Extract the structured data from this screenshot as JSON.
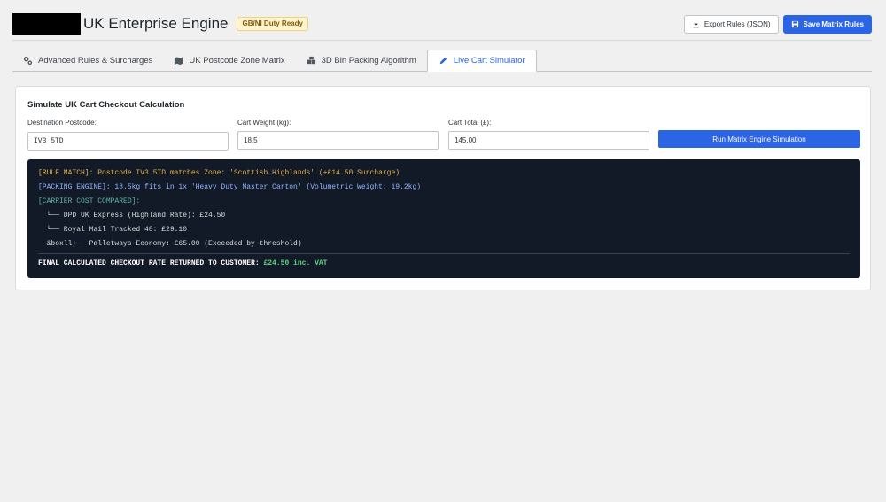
{
  "header": {
    "title": "UK Enterprise Engine",
    "badge": "GB/NI Duty Ready",
    "export_label": "Export Rules (JSON)",
    "save_label": "Save Matrix Rules"
  },
  "tabs": [
    {
      "label": "Advanced Rules & Surcharges",
      "icon": "gears-icon"
    },
    {
      "label": "UK Postcode Zone Matrix",
      "icon": "map-icon"
    },
    {
      "label": "3D Bin Packing Algorithm",
      "icon": "boxes-icon"
    },
    {
      "label": "Live Cart Simulator",
      "icon": "pencil-icon",
      "active": true
    }
  ],
  "simulator": {
    "title": "Simulate UK Cart Checkout Calculation",
    "postcode_label": "Destination Postcode:",
    "postcode_value": "IV3 5TD",
    "weight_label": "Cart Weight (kg):",
    "weight_value": "18.5",
    "total_label": "Cart Total (£):",
    "total_value": "145.00",
    "run_label": "Run Matrix Engine Simulation"
  },
  "console": {
    "rule_match": "[RULE MATCH]: Postcode IV3 5TD matches Zone: 'Scottish Highlands' (+£14.50 Surcharge)",
    "packing": "[PACKING ENGINE]: 18.5kg fits in 1x 'Heavy Duty Master Carton' (Volumetric Weight: 19.2kg)",
    "carrier_header": "[CARRIER COST COMPARED]:",
    "carrier_1": "  └── DPD UK Express (Highland Rate): £24.50",
    "carrier_2": "  └── Royal Mail Tracked 48: £29.10",
    "carrier_3": "  &boxll;── Palletways Economy: £65.00 (Exceeded by threshold)",
    "final_label": "FINAL CALCULATED CHECKOUT RATE RETURNED TO CUSTOMER: ",
    "final_value": "£24.50 inc. VAT"
  },
  "colors": {
    "accent": "#2c64e6",
    "console_bg": "#131a27",
    "success": "#5fd47b"
  }
}
